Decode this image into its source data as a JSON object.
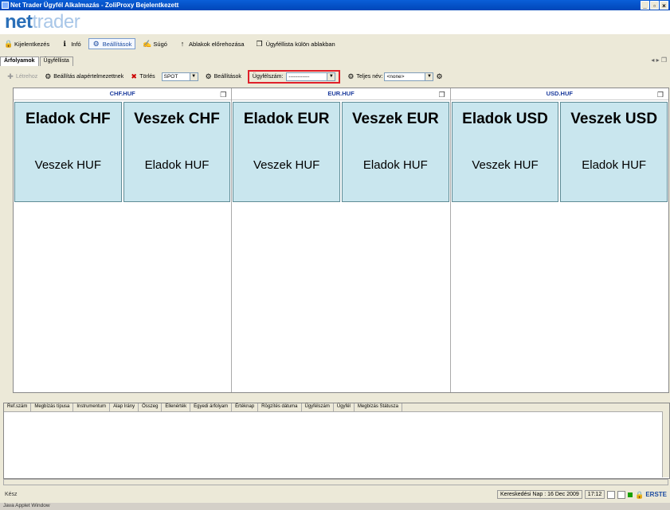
{
  "window": {
    "title": "Net Trader Ügyfél Alkalmazás - ZoliProxy Bejelentkezett",
    "buttons": [
      "_",
      "▫",
      "×"
    ]
  },
  "logo": {
    "part1": "net",
    "part2": "trader"
  },
  "menu": [
    {
      "label": "Kijelentkezés",
      "icon": "lock-icon",
      "glyph": "🔒"
    },
    {
      "label": "Infó",
      "icon": "info-icon",
      "glyph": "ℹ"
    },
    {
      "label": "Beállítások",
      "icon": "settings-icon",
      "glyph": "⚙",
      "selected": true
    },
    {
      "label": "Súgó",
      "icon": "help-icon",
      "glyph": "✍"
    },
    {
      "label": "Ablakok előrehozása",
      "icon": "arrow-up-icon",
      "glyph": "↑"
    },
    {
      "label": "Ügyféllista külön ablakban",
      "icon": "window-icon",
      "glyph": "❐"
    }
  ],
  "tabs": [
    {
      "label": "Árfolyamok",
      "active": true
    },
    {
      "label": "Ügyféllista",
      "active": false
    }
  ],
  "toolbar": {
    "create_label": "Létrehoz",
    "defaults_label": "Beállítás alapértelmezettnek",
    "delete_label": "Törlés",
    "spot_value": "SPOT",
    "settings_label": "Beállítások",
    "client_no_label": "Ügyfélszám:",
    "client_no_value": "------------",
    "fullname_label": "Teljes név:",
    "fullname_value": "<none>"
  },
  "panels": [
    {
      "pair": "CHF.HUF",
      "cells": [
        {
          "top": "Eladok CHF",
          "bottom": "Veszek HUF"
        },
        {
          "top": "Veszek CHF",
          "bottom": "Eladok HUF"
        }
      ]
    },
    {
      "pair": "EUR.HUF",
      "cells": [
        {
          "top": "Eladok EUR",
          "bottom": "Veszek HUF"
        },
        {
          "top": "Veszek EUR",
          "bottom": "Eladok HUF"
        }
      ]
    },
    {
      "pair": "USD.HUF",
      "cells": [
        {
          "top": "Eladok USD",
          "bottom": "Veszek HUF"
        },
        {
          "top": "Veszek USD",
          "bottom": "Eladok HUF"
        }
      ]
    }
  ],
  "orders_columns": [
    "Ref.szám",
    "Megbízás típusa",
    "Instrumentum",
    "Alap Irány",
    "Összeg",
    "Ellenérték",
    "Egyedi árfolyam",
    "Értéknap",
    "Rögzítés dátuma",
    "Ügyfélszám",
    "Ügyfél",
    "Megbízás Státusza"
  ],
  "status": {
    "left": "Kész",
    "trading_day": "Kereskedési Nap : 16 Dec 2009",
    "time": "17:12",
    "brand": "ERSTE"
  },
  "footer": "Java Applet Window"
}
